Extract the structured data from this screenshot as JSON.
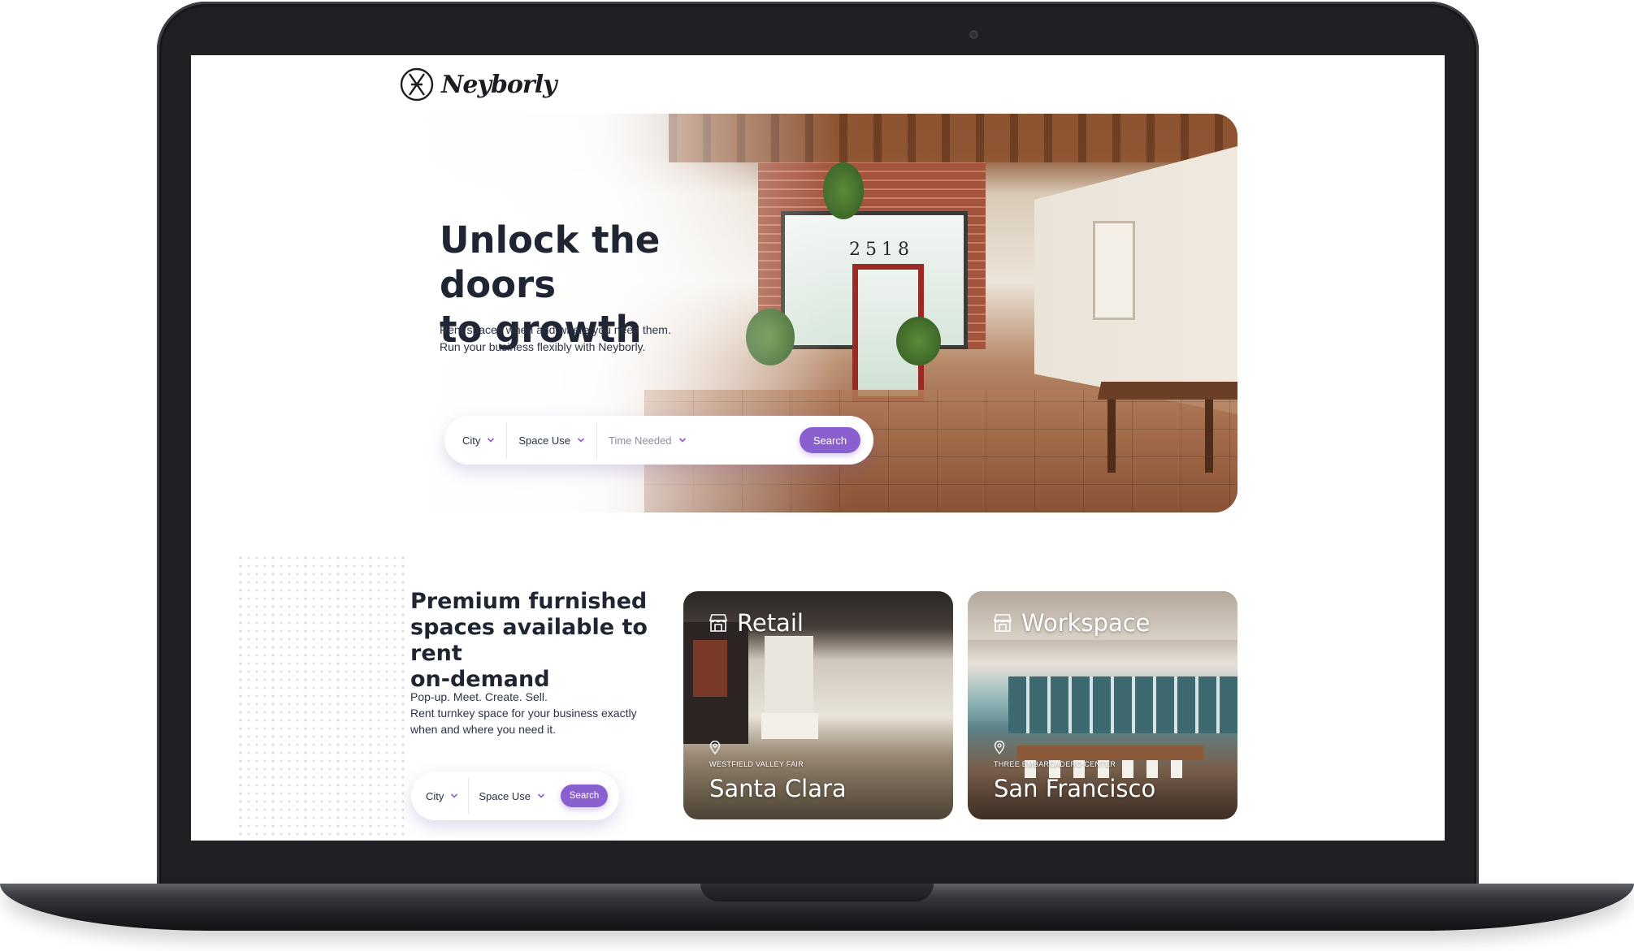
{
  "brand": {
    "name": "Neyborly"
  },
  "hero": {
    "title_line1": "Unlock the doors",
    "title_line2": "to growth",
    "subtitle_line1": "Rent spaces when and where you need them.",
    "subtitle_line2": "Run your business flexibly with Neyborly.",
    "door_number": "2518",
    "search": {
      "city_label": "City",
      "space_use_label": "Space Use",
      "time_needed_placeholder": "Time Needed",
      "search_label": "Search"
    }
  },
  "section": {
    "title_line1": "Premium furnished",
    "title_line2": "spaces available to rent",
    "title_line3": "on-demand",
    "body_line1": "Pop-up. Meet. Create. Sell.",
    "body_line2": "Rent turnkey space for your business exactly",
    "body_line3": "when and where you need it.",
    "search": {
      "city_label": "City",
      "space_use_label": "Space Use",
      "search_label": "Search"
    }
  },
  "cards": [
    {
      "category": "Retail",
      "venue": "WESTFIELD VALLEY FAIR",
      "city": "Santa Clara",
      "icon": "storefront-icon"
    },
    {
      "category": "Workspace",
      "venue": "THREE EMBARCADERO CENTER",
      "city": "San Francisco",
      "icon": "storefront-icon"
    }
  ],
  "colors": {
    "accent": "#8a5fd0",
    "heading": "#1f2533",
    "laptop_frame": "#1e2023"
  }
}
